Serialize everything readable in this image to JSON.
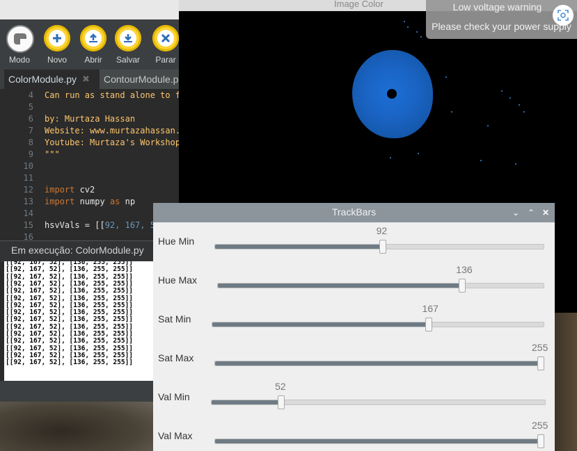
{
  "thonny": {
    "toolbar": [
      {
        "label": "Modo",
        "icon": "mode-icon"
      },
      {
        "label": "Novo",
        "icon": "plus-icon"
      },
      {
        "label": "Abrir",
        "icon": "upload-icon"
      },
      {
        "label": "Salvar",
        "icon": "download-icon"
      },
      {
        "label": "Parar",
        "icon": "stop-icon"
      }
    ],
    "tabs": [
      {
        "label": "ColorModule.py",
        "active": true
      },
      {
        "label": "ContourModule.p"
      }
    ],
    "editor_lines": [
      {
        "n": "4",
        "text": "Can run as stand alone to f"
      },
      {
        "n": "5",
        "text": ""
      },
      {
        "n": "6",
        "text": "by: Murtaza Hassan"
      },
      {
        "n": "7",
        "text": "Website: www.murtazahassan."
      },
      {
        "n": "8",
        "text": "Youtube: Murtaza's Workshop"
      },
      {
        "n": "9",
        "text": "\"\"\""
      },
      {
        "n": "10",
        "text": ""
      },
      {
        "n": "11",
        "text": ""
      },
      {
        "n": "12",
        "kw": "import",
        "text": " cv2"
      },
      {
        "n": "13",
        "kw": "import",
        "text": " numpy ",
        "kw2": "as",
        "text2": " np"
      },
      {
        "n": "14",
        "text": ""
      },
      {
        "n": "15",
        "text": "hsvVals = [[",
        "nums": "92, 167, 5"
      },
      {
        "n": "16",
        "text": ""
      }
    ],
    "run_status": "Em execução: ColorModule.py",
    "shell_line": "[[92, 167, 52], [136, 255, 255]]",
    "shell_line_count": 15
  },
  "image_window": {
    "title": "Image Color"
  },
  "notification": {
    "title": "Low voltage warning",
    "body": "Please check your power supply",
    "icon": "screenshot-icon"
  },
  "trackbars": {
    "title": "TrackBars",
    "controls": [
      "chevron-down-icon",
      "chevron-up-icon",
      "close-icon"
    ],
    "sliders": [
      {
        "label": "Hue Min",
        "value": "92",
        "fraction": 0.51
      },
      {
        "label": "Hue Max",
        "value": "136",
        "fraction": 0.755
      },
      {
        "label": "Sat Min",
        "value": "167",
        "fraction": 0.655
      },
      {
        "label": "Sat Max",
        "value": "255",
        "fraction": 1.0
      },
      {
        "label": "Val Min",
        "value": "52",
        "fraction": 0.204
      },
      {
        "label": "Val Max",
        "value": "255",
        "fraction": 1.0
      }
    ]
  },
  "colors": {
    "accent_gold": "#fcd434",
    "mask_blue": "#1a64c4",
    "trackbar_fill": "#6f7b84"
  }
}
